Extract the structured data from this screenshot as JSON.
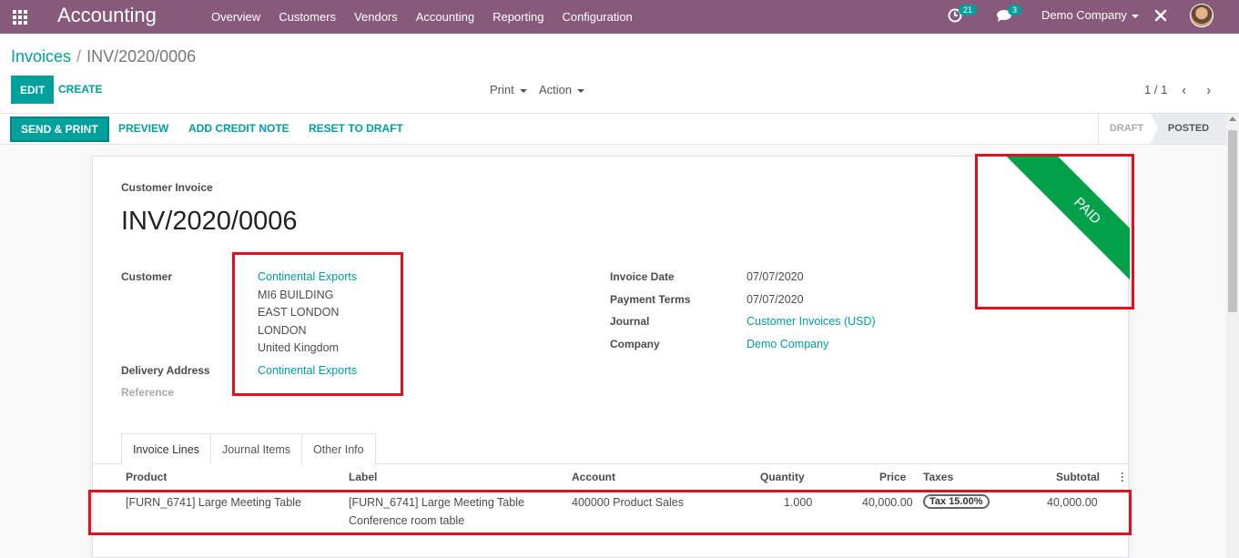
{
  "navbar": {
    "app_title": "Accounting",
    "menu": [
      "Overview",
      "Customers",
      "Vendors",
      "Accounting",
      "Reporting",
      "Configuration"
    ],
    "activity_count": "21",
    "message_count": "3",
    "company": "Demo Company"
  },
  "breadcrumb": {
    "parent": "Invoices",
    "separator": "/",
    "current": "INV/2020/0006"
  },
  "toolbar": {
    "edit": "EDIT",
    "create": "CREATE",
    "print": "Print",
    "action": "Action"
  },
  "pager": {
    "value": "1 / 1"
  },
  "statusbar": {
    "buttons": [
      "SEND & PRINT",
      "PREVIEW",
      "ADD CREDIT NOTE",
      "RESET TO DRAFT"
    ],
    "stages": [
      "DRAFT",
      "POSTED"
    ],
    "active_stage": "POSTED"
  },
  "invoice": {
    "type": "Customer Invoice",
    "number": "INV/2020/0006",
    "ribbon": "PAID",
    "customer_label": "Customer",
    "customer_name": "Continental Exports",
    "address_lines": [
      "MI6 BUILDING",
      "EAST LONDON",
      "LONDON",
      "United Kingdom"
    ],
    "delivery_label": "Delivery Address",
    "delivery_value": "Continental Exports",
    "reference_label": "Reference",
    "fields": [
      {
        "label": "Invoice Date",
        "value": "07/07/2020",
        "link": false
      },
      {
        "label": "Payment Terms",
        "value": "07/07/2020",
        "link": false
      },
      {
        "label": "Journal",
        "value": "Customer Invoices (USD)",
        "link": true
      },
      {
        "label": "Company",
        "value": "Demo Company",
        "link": true
      }
    ]
  },
  "tabs": [
    "Invoice Lines",
    "Journal Items",
    "Other Info"
  ],
  "table": {
    "headers": [
      "Product",
      "Label",
      "Account",
      "Quantity",
      "Price",
      "Taxes",
      "Subtotal"
    ],
    "rows": [
      {
        "product": "[FURN_6741] Large Meeting Table",
        "label_line1": "[FURN_6741] Large Meeting Table",
        "label_line2": "Conference room table",
        "account": "400000 Product Sales",
        "quantity": "1.000",
        "price": "40,000.00",
        "tax": "Tax 15.00%",
        "subtotal": "40,000.00"
      }
    ]
  },
  "colors": {
    "navbar": "#875a7b",
    "primary": "#00a09d",
    "ribbon": "#00a149",
    "highlight": "#e2101e"
  }
}
